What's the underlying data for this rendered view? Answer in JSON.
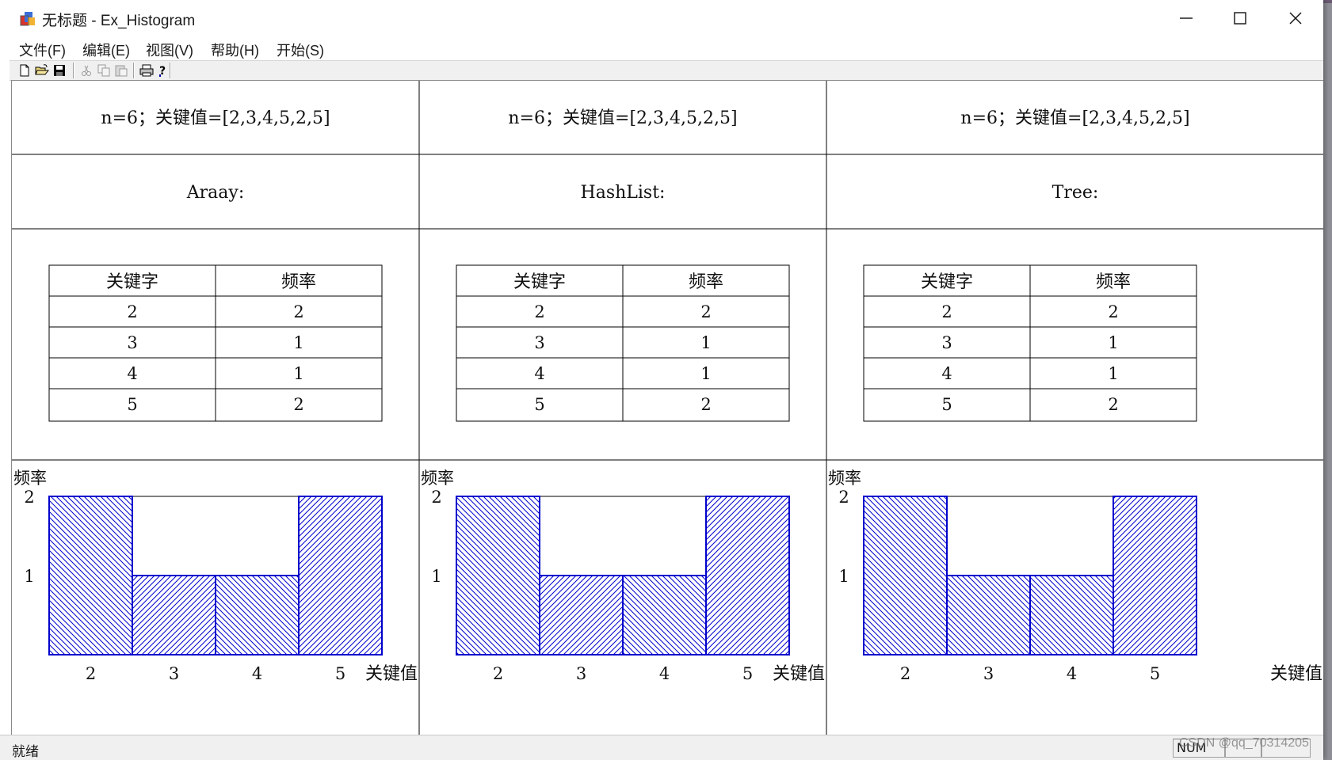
{
  "window": {
    "title": "无标题 - Ex_Histogram"
  },
  "menu": {
    "items": [
      "文件(F)",
      "编辑(E)",
      "视图(V)",
      "帮助(H)",
      "开始(S)"
    ]
  },
  "toolbar": {
    "buttons": [
      "new-file-icon",
      "open-folder-icon",
      "save-icon",
      "cut-icon",
      "copy-icon",
      "paste-icon",
      "print-icon",
      "help-icon"
    ]
  },
  "panels": [
    {
      "header": "n=6；关键值=[2,3,4,5,2,5]",
      "method": "Araay:",
      "table": {
        "columns": [
          "关键字",
          "频率"
        ],
        "rows": [
          [
            "2",
            "2"
          ],
          [
            "3",
            "1"
          ],
          [
            "4",
            "1"
          ],
          [
            "5",
            "2"
          ]
        ]
      }
    },
    {
      "header": "n=6；关键值=[2,3,4,5,2,5]",
      "method": "HashList:",
      "table": {
        "columns": [
          "关键字",
          "频率"
        ],
        "rows": [
          [
            "2",
            "2"
          ],
          [
            "3",
            "1"
          ],
          [
            "4",
            "1"
          ],
          [
            "5",
            "2"
          ]
        ]
      }
    },
    {
      "header": "n=6；关键值=[2,3,4,5,2,5]",
      "method": "Tree:",
      "table": {
        "columns": [
          "关键字",
          "频率"
        ],
        "rows": [
          [
            "2",
            "2"
          ],
          [
            "3",
            "1"
          ],
          [
            "4",
            "1"
          ],
          [
            "5",
            "2"
          ]
        ]
      }
    }
  ],
  "chart_data": [
    {
      "type": "bar",
      "categories": [
        "2",
        "3",
        "4",
        "5"
      ],
      "values": [
        2,
        1,
        1,
        2
      ],
      "xlabel": "关键值",
      "ylabel": "频率",
      "yticks": [
        "1",
        "2"
      ],
      "ylim": [
        0,
        2
      ],
      "grid": false,
      "legend": "none",
      "color": "#0000cc",
      "hatch": [
        "backslash",
        "slash",
        "backslash",
        "slash"
      ]
    },
    {
      "type": "bar",
      "categories": [
        "2",
        "3",
        "4",
        "5"
      ],
      "values": [
        2,
        1,
        1,
        2
      ],
      "xlabel": "关键值",
      "ylabel": "频率",
      "yticks": [
        "1",
        "2"
      ],
      "ylim": [
        0,
        2
      ],
      "grid": false,
      "legend": "none",
      "color": "#0000cc",
      "hatch": [
        "backslash",
        "slash",
        "backslash",
        "slash"
      ]
    },
    {
      "type": "bar",
      "categories": [
        "2",
        "3",
        "4",
        "5"
      ],
      "values": [
        2,
        1,
        1,
        2
      ],
      "xlabel": "关键值",
      "ylabel": "频率",
      "yticks": [
        "1",
        "2"
      ],
      "ylim": [
        0,
        2
      ],
      "grid": false,
      "legend": "none",
      "color": "#0000cc",
      "hatch": [
        "backslash",
        "backslash",
        "backslash",
        "slash"
      ]
    }
  ],
  "status": {
    "text": "就绪",
    "num": "NUM"
  },
  "watermark": "CSDN @qq_70314205"
}
